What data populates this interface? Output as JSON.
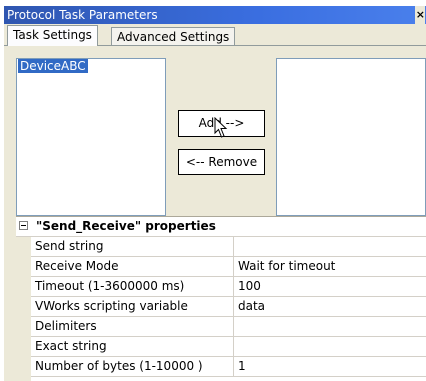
{
  "window": {
    "title": "Protocol Task Parameters",
    "close_glyph": "×"
  },
  "tabs": [
    {
      "label": "Task Settings"
    },
    {
      "label": "Advanced Settings"
    }
  ],
  "available_list": {
    "items": [
      "DeviceABC"
    ]
  },
  "buttons": {
    "add_label": "Add -->",
    "remove_label": "<-- Remove"
  },
  "properties": {
    "header": "\"Send_Receive\" properties",
    "rows": [
      {
        "name": "Send string",
        "value": ""
      },
      {
        "name": "Receive Mode",
        "value": "Wait for timeout"
      },
      {
        "name": "Timeout (1-3600000 ms)",
        "value": "100"
      },
      {
        "name": "VWorks scripting variable",
        "value": "data"
      },
      {
        "name": "Delimiters",
        "value": ""
      },
      {
        "name": "Exact string",
        "value": ""
      },
      {
        "name": "Number of bytes (1-10000 )",
        "value": "1"
      }
    ]
  },
  "colors": {
    "titlebar": "#3a6ee0",
    "selection": "#316ac5",
    "panel": "#ece9d8"
  }
}
